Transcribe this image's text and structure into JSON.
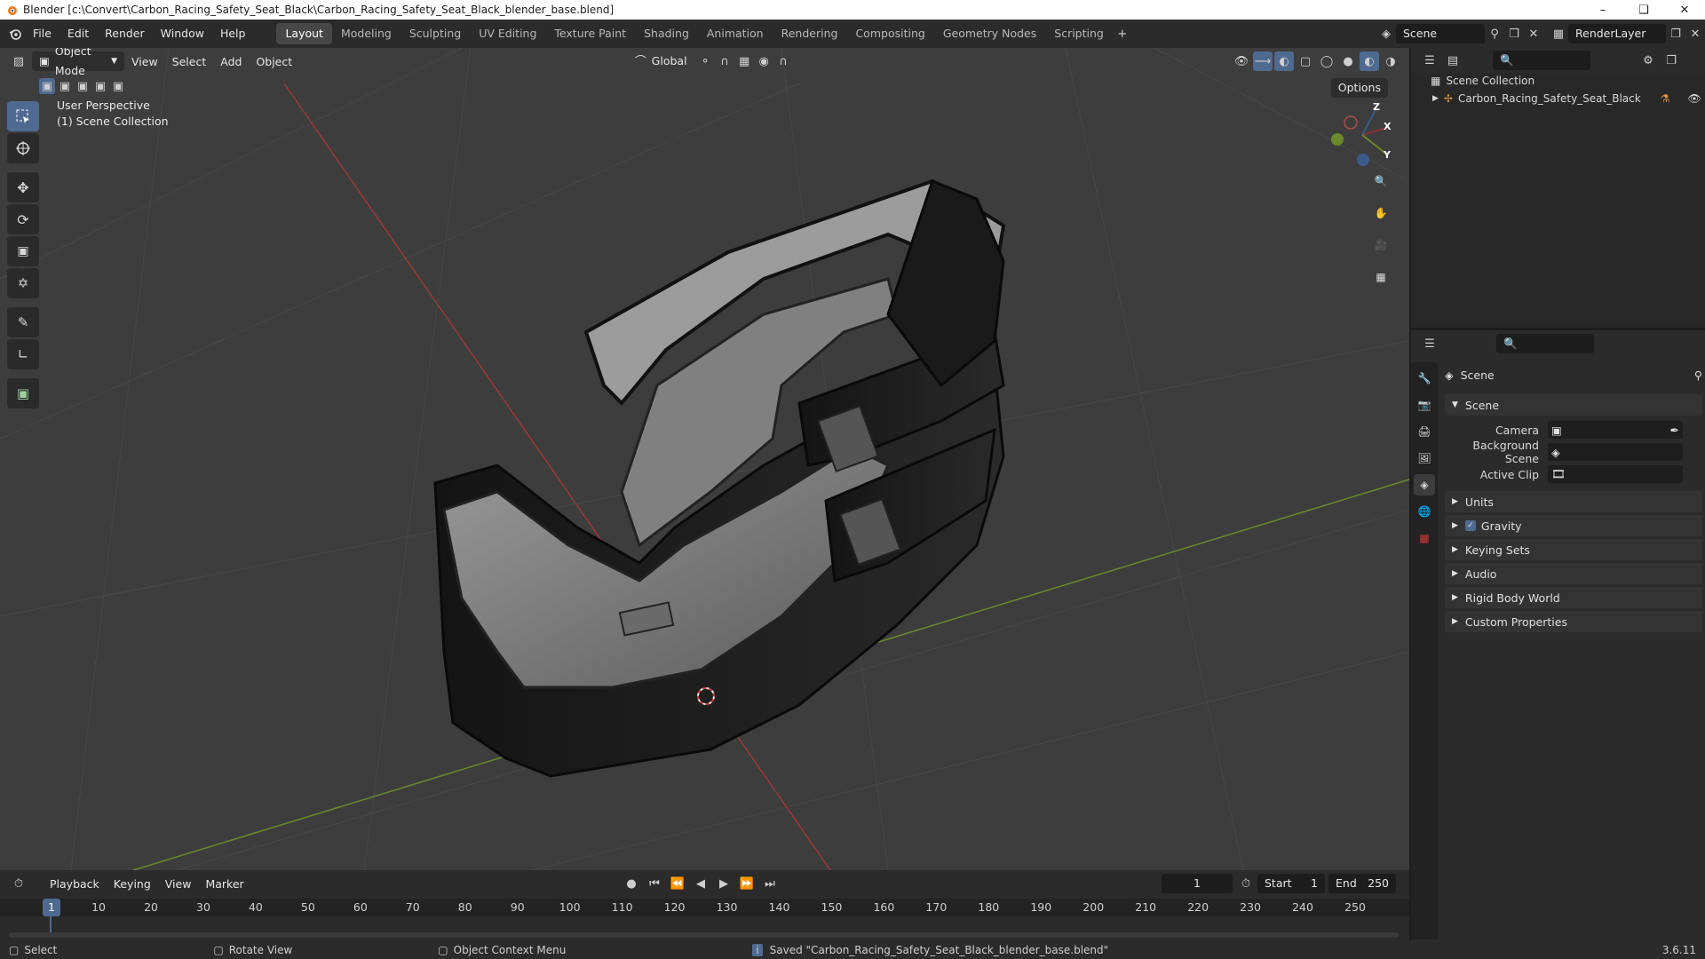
{
  "window": {
    "title": "Blender [c:\\Convert\\Carbon_Racing_Safety_Seat_Black\\Carbon_Racing_Safety_Seat_Black_blender_base.blend]"
  },
  "menu": [
    "File",
    "Edit",
    "Render",
    "Window",
    "Help"
  ],
  "workspaces": [
    "Layout",
    "Modeling",
    "Sculpting",
    "UV Editing",
    "Texture Paint",
    "Shading",
    "Animation",
    "Rendering",
    "Compositing",
    "Geometry Nodes",
    "Scripting"
  ],
  "active_workspace": "Layout",
  "scene_field": "Scene",
  "render_layer_field": "RenderLayer",
  "viewport": {
    "mode": "Object Mode",
    "menus": [
      "View",
      "Select",
      "Add",
      "Object"
    ],
    "transform_orientation": "Global",
    "options_label": "Options",
    "perspective": "User Perspective",
    "collection": "(1) Scene Collection",
    "gizmo": {
      "x": "X",
      "y": "Y",
      "z": "Z"
    }
  },
  "outliner": {
    "root": "Scene Collection",
    "items": [
      "Carbon_Racing_Safety_Seat_Black"
    ]
  },
  "properties": {
    "context": "Scene",
    "panel": "Scene",
    "fields": [
      {
        "label": "Camera"
      },
      {
        "label": "Background Scene"
      },
      {
        "label": "Active Clip"
      }
    ],
    "sections": [
      "Units",
      "Gravity",
      "Keying Sets",
      "Audio",
      "Rigid Body World",
      "Custom Properties"
    ],
    "gravity_checked": true
  },
  "timeline": {
    "menus": [
      "Playback",
      "Keying",
      "View",
      "Marker"
    ],
    "current_frame": "1",
    "start_label": "Start",
    "start": "1",
    "end_label": "End",
    "end": "250",
    "ruler": [
      "1",
      "10",
      "20",
      "30",
      "40",
      "50",
      "60",
      "70",
      "80",
      "90",
      "100",
      "110",
      "120",
      "130",
      "140",
      "150",
      "160",
      "170",
      "180",
      "190",
      "200",
      "210",
      "220",
      "230",
      "240",
      "250"
    ]
  },
  "status": {
    "select": "Select",
    "rotate": "Rotate View",
    "context_menu": "Object Context Menu",
    "message": "Saved \"Carbon_Racing_Safety_Seat_Black_blender_base.blend\"",
    "version": "3.6.11"
  }
}
